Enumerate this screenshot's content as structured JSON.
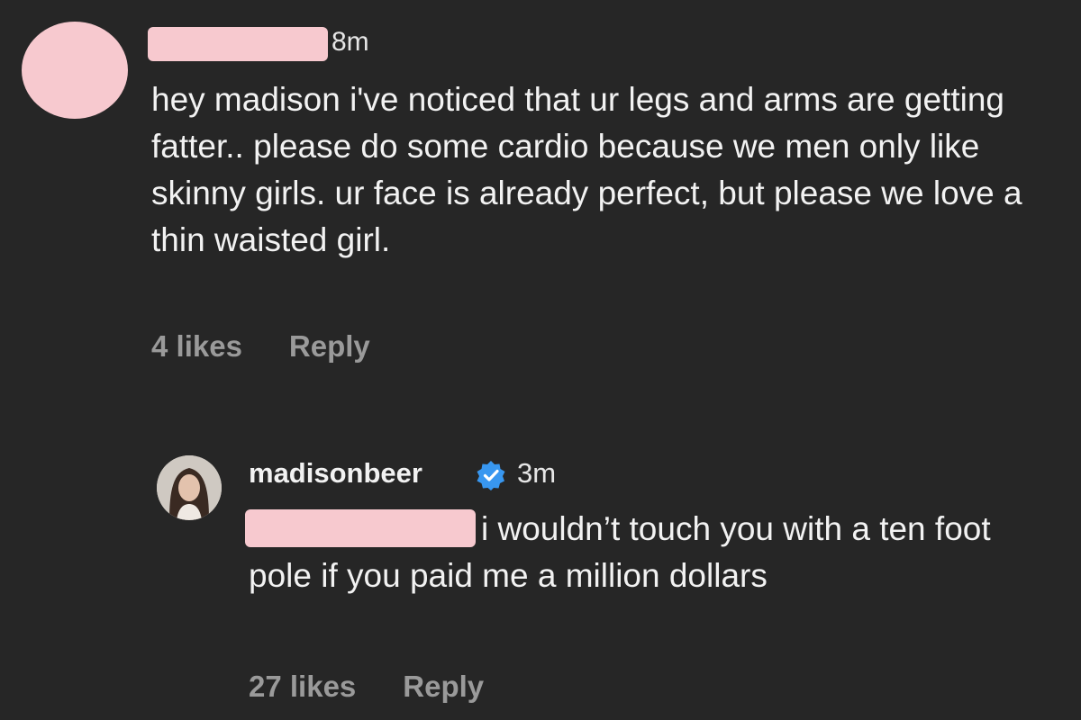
{
  "comments": [
    {
      "username": "",
      "time": "8m",
      "text": "hey madison i've noticed that ur legs and arms are getting fatter.. please do some cardio because we men only like skinny girls. ur face is already perfect, but please we love a thin waisted girl.",
      "likes": "4 likes",
      "reply_label": "Reply"
    },
    {
      "username": "madisonbeer",
      "verified": true,
      "time": "3m",
      "text": "i wouldn’t touch you with a ten foot pole if you paid me a million dollars",
      "likes": "27 likes",
      "reply_label": "Reply"
    }
  ],
  "colors": {
    "background": "#262626",
    "text": "#f2f2f2",
    "meta_text": "#9a9a9a",
    "redaction": "#f7c9cf",
    "verified_badge": "#3897f0"
  },
  "icons": {
    "verified": "verified-badge-icon"
  }
}
